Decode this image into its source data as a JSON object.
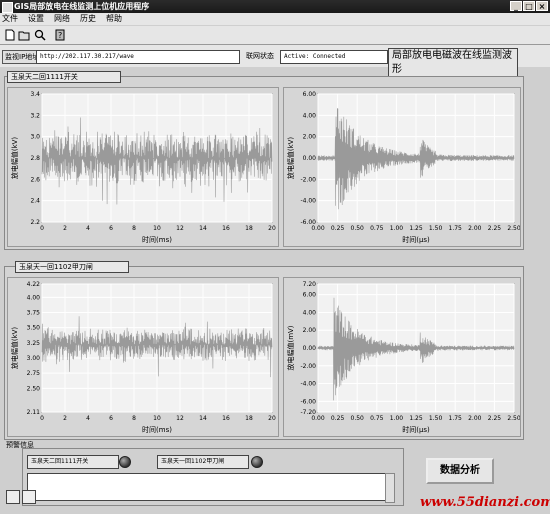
{
  "window": {
    "title": "GIS局部放电在线监测上位机应用程序",
    "min": "_",
    "max": "□",
    "close": "×"
  },
  "menu": [
    "文件",
    "设置",
    "网络",
    "历史",
    "帮助"
  ],
  "toolbar_icons": [
    "new-document-icon",
    "open-document-icon",
    "search-icon",
    "help-icon"
  ],
  "address": {
    "label": "监视IP地址",
    "value": "http://202.117.30.217/wave"
  },
  "network": {
    "label": "联网状态",
    "value": "Active: Connected"
  },
  "banner": "局部放电电磁波在线监测波形",
  "panels": [
    {
      "title": "玉泉天二回1111开关"
    },
    {
      "title": "玉泉天一回1102甲刀闸"
    }
  ],
  "alarm": {
    "title": "预警信息",
    "item1": "玉泉天二回1111开关",
    "item2": "玉泉天一回1102甲刀闸",
    "button": "数据分析"
  },
  "watermark": "www.55dianzi.com",
  "colors": {
    "plot_bg": "#f2f2f2",
    "grid": "#ffffff",
    "signal": "#9a9a9a"
  },
  "chart_data": [
    {
      "type": "line",
      "title": "",
      "xlabel": "时间(ms)",
      "ylabel": "放电幅值(kV)",
      "x_ticks": [
        "0",
        "2",
        "4",
        "6",
        "8",
        "10",
        "12",
        "14",
        "16",
        "18",
        "20"
      ],
      "y_ticks": [
        "2.2",
        "2.4",
        "2.6",
        "2.8",
        "3.0",
        "3.2",
        "3.4"
      ],
      "xlim": [
        0,
        20
      ],
      "ylim": [
        2.2,
        3.4
      ],
      "signal": {
        "center": 2.8,
        "amplitude": 0.28,
        "spikes": 0.45
      }
    },
    {
      "type": "line",
      "title": "",
      "xlabel": "时间(μs)",
      "ylabel": "放电幅值(kV)",
      "x_ticks": [
        "0.00",
        "0.25",
        "0.50",
        "0.75",
        "1.00",
        "1.25",
        "1.50",
        "1.75",
        "2.00",
        "2.25",
        "2.50"
      ],
      "y_ticks": [
        "-6.00",
        "-4.00",
        "-2.00",
        "0.00",
        "2.00",
        "4.00",
        "6.00"
      ],
      "xlim": [
        0,
        2.5
      ],
      "ylim": [
        -6.0,
        6.0
      ],
      "signal": {
        "burst_at": 0.22,
        "peak": 5.5,
        "decay": 0.9
      }
    },
    {
      "type": "line",
      "title": "",
      "xlabel": "时间(ms)",
      "ylabel": "放电幅值(kV)",
      "x_ticks": [
        "0",
        "2",
        "4",
        "6",
        "8",
        "10",
        "12",
        "14",
        "16",
        "18",
        "20"
      ],
      "y_ticks": [
        "2.11",
        "2.50",
        "2.75",
        "3.00",
        "3.25",
        "3.50",
        "3.75",
        "4.00",
        "4.22"
      ],
      "xlim": [
        0,
        20
      ],
      "ylim": [
        2.11,
        4.22
      ],
      "signal": {
        "center": 3.22,
        "amplitude": 0.3,
        "spikes": 0.55
      }
    },
    {
      "type": "line",
      "title": "",
      "xlabel": "时间(μs)",
      "ylabel": "放电幅值(mV)",
      "x_ticks": [
        "0.00",
        "0.25",
        "0.50",
        "0.75",
        "1.00",
        "1.25",
        "1.50",
        "1.75",
        "2.00",
        "2.25",
        "2.50"
      ],
      "y_ticks": [
        "-7.20",
        "-6.00",
        "-4.00",
        "-2.00",
        "0.00",
        "2.00",
        "4.00",
        "6.00",
        "7.20"
      ],
      "xlim": [
        0,
        2.5
      ],
      "ylim": [
        -7.2,
        7.2
      ],
      "signal": {
        "burst_at": 0.2,
        "peak": 5.8,
        "decay": 0.8
      }
    }
  ]
}
